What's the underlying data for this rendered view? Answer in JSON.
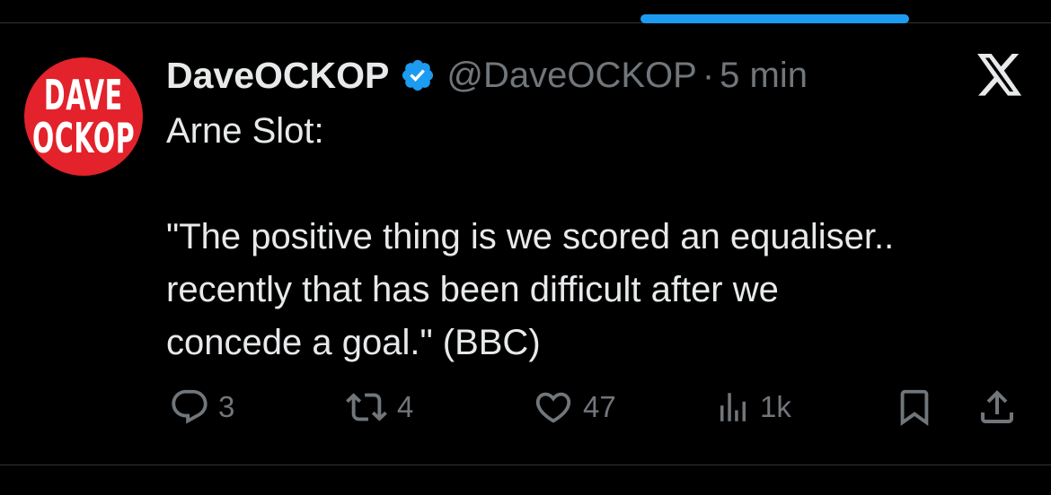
{
  "tweet": {
    "author": {
      "display_name": "DaveOCKOP",
      "handle": "@DaveOCKOP",
      "verified": true,
      "avatar_text_line1": "DAVE",
      "avatar_text_line2": "OCKOP",
      "avatar_color": "#e3222b"
    },
    "separator": "·",
    "time": "5 min",
    "text_lines": [
      "Arne Slot:",
      "",
      "\"The positive thing is we scored an equaliser..",
      "recently that has been difficult after we",
      "concede a goal.\" (BBC)"
    ],
    "actions": {
      "replies": "3",
      "reposts": "4",
      "likes": "47",
      "views": "1k"
    }
  },
  "icons": {
    "platform": "x-logo-icon",
    "verified": "verified-badge-icon",
    "reply": "reply-icon",
    "repost": "repost-icon",
    "like": "heart-icon",
    "views": "views-icon",
    "bookmark": "bookmark-icon",
    "share": "share-icon"
  },
  "colors": {
    "background": "#000000",
    "text_primary": "#e7e9ea",
    "text_secondary": "#71767b",
    "accent": "#1d9bf0",
    "divider": "#2f3336"
  }
}
